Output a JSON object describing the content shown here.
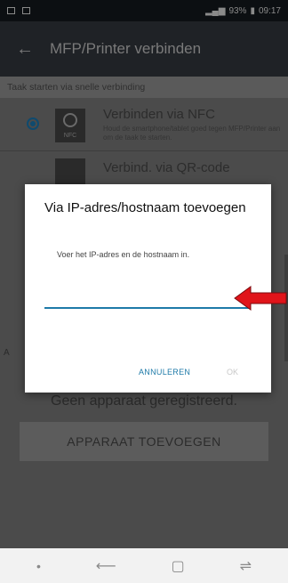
{
  "status_bar": {
    "time": "09:17",
    "battery": "93%"
  },
  "app_bar": {
    "title": "MFP/Printer verbinden"
  },
  "quick_section": {
    "header": "Taak starten via snelle verbinding",
    "nfc": {
      "icon_label": "NFC",
      "title": "Verbinden via NFC",
      "description": "Houd de smartphone/tablet goed tegen MFP/Printer aan om de taak te starten."
    },
    "qr": {
      "title": "Verbind. via QR-code"
    }
  },
  "no_devices_text": "Geen apparaat geregistreerd.",
  "add_button_label": "APPARAAT TOEVOEGEN",
  "dialog": {
    "title": "Via IP-adres/hostnaam toevoegen",
    "message": "Voer het IP-adres en de hostnaam in.",
    "input_value": "",
    "cancel_label": "ANNULEREN",
    "ok_label": "OK",
    "accent_color": "#1e7aa8"
  },
  "annotation": {
    "arrow_color": "#e0141a"
  }
}
